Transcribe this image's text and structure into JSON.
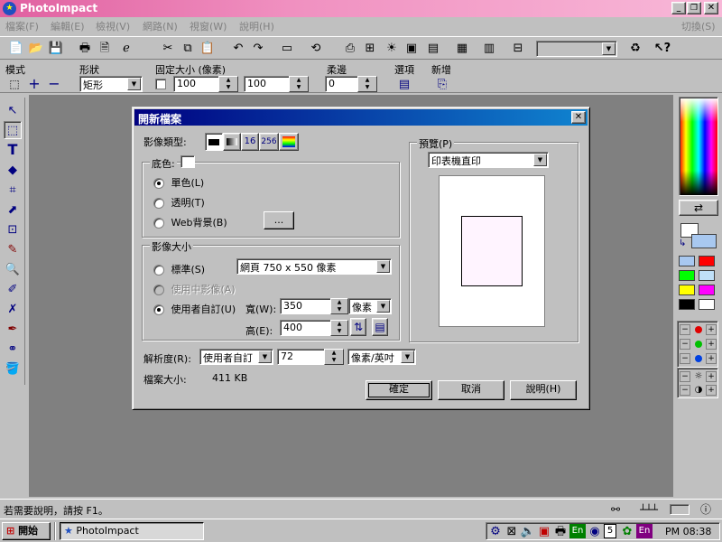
{
  "app": {
    "title": "PhotoImpact",
    "switch_label": "切換(S)"
  },
  "menu": [
    "檔案(F)",
    "編輯(E)",
    "檢視(V)",
    "網路(N)",
    "視窗(W)",
    "說明(H)"
  ],
  "toolbar": {
    "zoom_value": ""
  },
  "attr_bar": {
    "mode_label": "模式",
    "shape_label": "形狀",
    "shape_value": "矩形",
    "fixed_size_label": "固定大小 (像素)",
    "width_value": "100",
    "height_value": "100",
    "feather_label": "柔邊",
    "feather_value": "0",
    "options_label": "選項",
    "new_label": "新增"
  },
  "dialog": {
    "title": "開新檔案",
    "image_type_label": "影像類型:",
    "image_type_icons": [
      "16",
      "256"
    ],
    "bg_group_label": "底色:",
    "bg_options": [
      "單色(L)",
      "透明(T)",
      "Web背景(B)"
    ],
    "browse_label": "...",
    "size_group_label": "影像大小",
    "standard_label": "標準(S)",
    "standard_value": "網頁 750 x 550 像素",
    "use_active_label": "使用中影像(A)",
    "custom_label": "使用者自訂(U)",
    "width_label": "寬(W):",
    "width_value": "350",
    "height_label": "高(E):",
    "height_value": "400",
    "unit_value": "像素",
    "resolution_label": "解析度(R):",
    "resolution_mode": "使用者自訂",
    "resolution_value": "72",
    "resolution_unit": "像素/英吋",
    "filesize_label": "檔案大小:",
    "filesize_value": "411 KB",
    "preview_label": "預覽(P)",
    "preview_select": "印表機直印",
    "ok": "確定",
    "cancel": "取消",
    "help": "說明(H)"
  },
  "status": {
    "text": "若需要說明，請按 F1。"
  },
  "taskbar": {
    "start": "開始",
    "task": "PhotoImpact",
    "time": "PM 08:38",
    "tray_en1": "En",
    "tray_num": "5",
    "tray_en2": "En"
  },
  "palette_colors": [
    "#a8c8f0",
    "#ff0000",
    "#00ff00",
    "#c0e0f8",
    "#ffff00",
    "#ff00ff",
    "#000000",
    "#ffffff"
  ]
}
